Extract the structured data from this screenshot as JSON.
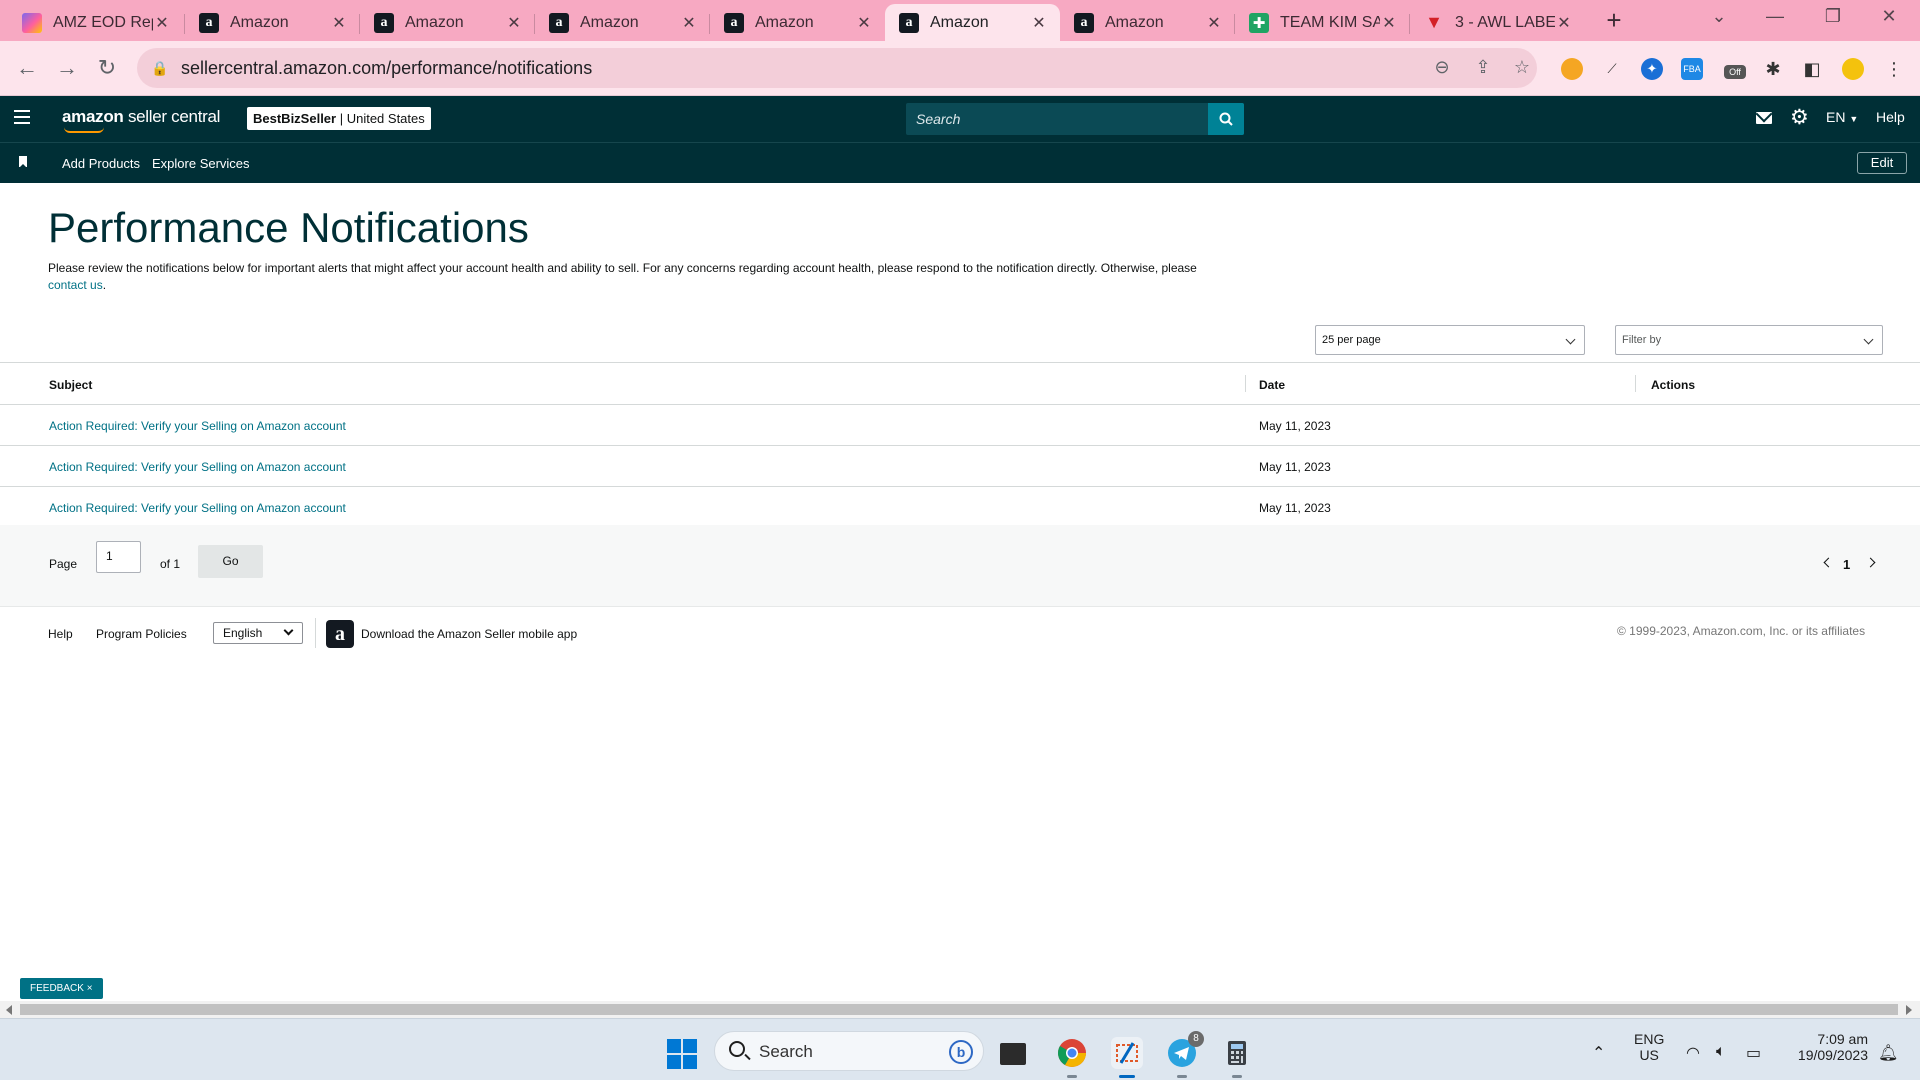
{
  "browser": {
    "tabs": [
      {
        "title": "AMZ EOD Rep",
        "favicon": "clickup-icon",
        "active": false
      },
      {
        "title": "Amazon",
        "favicon": "amazon-icon",
        "active": false
      },
      {
        "title": "Amazon",
        "favicon": "amazon-icon",
        "active": false
      },
      {
        "title": "Amazon",
        "favicon": "amazon-icon",
        "active": false
      },
      {
        "title": "Amazon",
        "favicon": "amazon-icon",
        "active": false
      },
      {
        "title": "Amazon",
        "favicon": "amazon-icon",
        "active": true
      },
      {
        "title": "Amazon",
        "favicon": "amazon-icon",
        "active": false
      },
      {
        "title": "TEAM KIM SA",
        "favicon": "sheets-icon",
        "active": false
      },
      {
        "title": "3 - AWL LABE",
        "favicon": "awl-icon",
        "active": false
      }
    ],
    "url": "sellercentral.amazon.com/performance/notifications",
    "extension_badge": "Off",
    "fba_label": "FBA"
  },
  "header": {
    "logo_brand": "amazon",
    "logo_product": "seller central",
    "store_name": "BestBizSeller",
    "store_region": "United States",
    "search_placeholder": "Search",
    "language": "EN",
    "help": "Help"
  },
  "subnav": {
    "links": [
      "Add Products",
      "Explore Services"
    ],
    "edit_label": "Edit"
  },
  "page": {
    "title": "Performance Notifications",
    "intro": "Please review the notifications below for important alerts that might affect your account health and ability to sell. For any concerns regarding account health, please respond to the notification directly. Otherwise, please",
    "intro_link": "contact us",
    "intro_end": ".",
    "per_page_value": "25 per page",
    "filter_placeholder": "Filter by"
  },
  "table": {
    "columns": [
      "Subject",
      "Date",
      "Actions"
    ],
    "rows": [
      {
        "subject": "Action Required: Verify your Selling on Amazon account",
        "date": "May 11, 2023",
        "actions": ""
      },
      {
        "subject": "Action Required: Verify your Selling on Amazon account",
        "date": "May 11, 2023",
        "actions": ""
      },
      {
        "subject": "Action Required: Verify your Selling on Amazon account",
        "date": "May 11, 2023",
        "actions": ""
      }
    ]
  },
  "pagination": {
    "page_label": "Page",
    "page_value": "1",
    "of_label": "of 1",
    "go_label": "Go",
    "current_page": "1"
  },
  "footer": {
    "help": "Help",
    "program_policies": "Program Policies",
    "language": "English",
    "app_text": "Download the Amazon Seller mobile app",
    "copyright": "© 1999-2023, Amazon.com, Inc. or its affiliates"
  },
  "feedback": {
    "label": "FEEDBACK",
    "close": "×"
  },
  "taskbar": {
    "search_placeholder": "Search",
    "telegram_badge": "8",
    "language_top": "ENG",
    "language_bottom": "US",
    "time": "7:09 am",
    "date": "19/09/2023"
  },
  "colors": {
    "header_bg": "#002f36",
    "link": "#007185",
    "tabstrip": "#f7a9c2",
    "search_button": "#008296"
  }
}
